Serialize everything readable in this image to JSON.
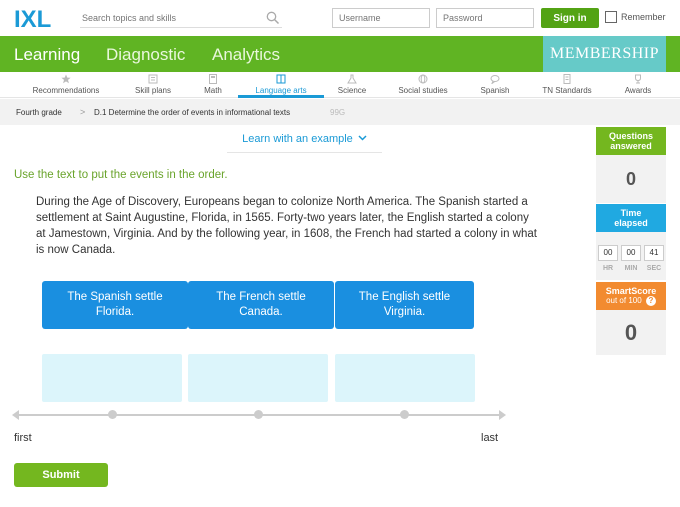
{
  "header": {
    "logo_text": "IXL",
    "search_placeholder": "Search topics and skills",
    "username_placeholder": "Username",
    "password_placeholder": "Password",
    "signin_label": "Sign in",
    "remember_label": "Remember"
  },
  "nav": {
    "items": [
      {
        "label": "Learning"
      },
      {
        "label": "Diagnostic"
      },
      {
        "label": "Analytics"
      }
    ],
    "membership": "MEMBERSHIP"
  },
  "subnav": {
    "items": [
      {
        "label": "Recommendations"
      },
      {
        "label": "Skill plans"
      },
      {
        "label": "Math"
      },
      {
        "label": "Language arts"
      },
      {
        "label": "Science"
      },
      {
        "label": "Social studies"
      },
      {
        "label": "Spanish"
      },
      {
        "label": "TN Standards"
      },
      {
        "label": "Awards"
      }
    ]
  },
  "breadcrumb": {
    "grade": "Fourth grade",
    "separator": ">",
    "skill": "D.1 Determine the order of events in informational texts",
    "code": "99G"
  },
  "learn_link": "Learn with an example",
  "question": {
    "instruction": "Use the text to put the events in the order.",
    "passage": "During the Age of Discovery, Europeans began to colonize North America. The Spanish started a settlement at Saint Augustine, Florida, in 1565. Forty-two years later, the English started a colony at Jamestown, Virginia. And by the following year, in 1608, the French had started a colony in what is now Canada.",
    "tiles": [
      "The Spanish settle Florida.",
      "The French settle Canada.",
      "The English settle Virginia."
    ],
    "timeline_first": "first",
    "timeline_last": "last",
    "submit_label": "Submit"
  },
  "sidebar": {
    "questions_title": "Questions answered",
    "questions_value": "0",
    "time_title": "Time elapsed",
    "time": {
      "hr": "00",
      "min": "00",
      "sec": "41"
    },
    "time_labels": {
      "hr": "HR",
      "min": "MIN",
      "sec": "SEC"
    },
    "smartscore_title": "SmartScore",
    "smartscore_sub": "out of 100",
    "smartscore_help": "?",
    "smartscore_value": "0"
  },
  "colors": {
    "brand_green": "#60b423",
    "tile_blue": "#1a8fe0",
    "slot_blue": "#dcf5fb",
    "membership_teal": "#66cac8",
    "smartscore_orange": "#f28b30"
  }
}
